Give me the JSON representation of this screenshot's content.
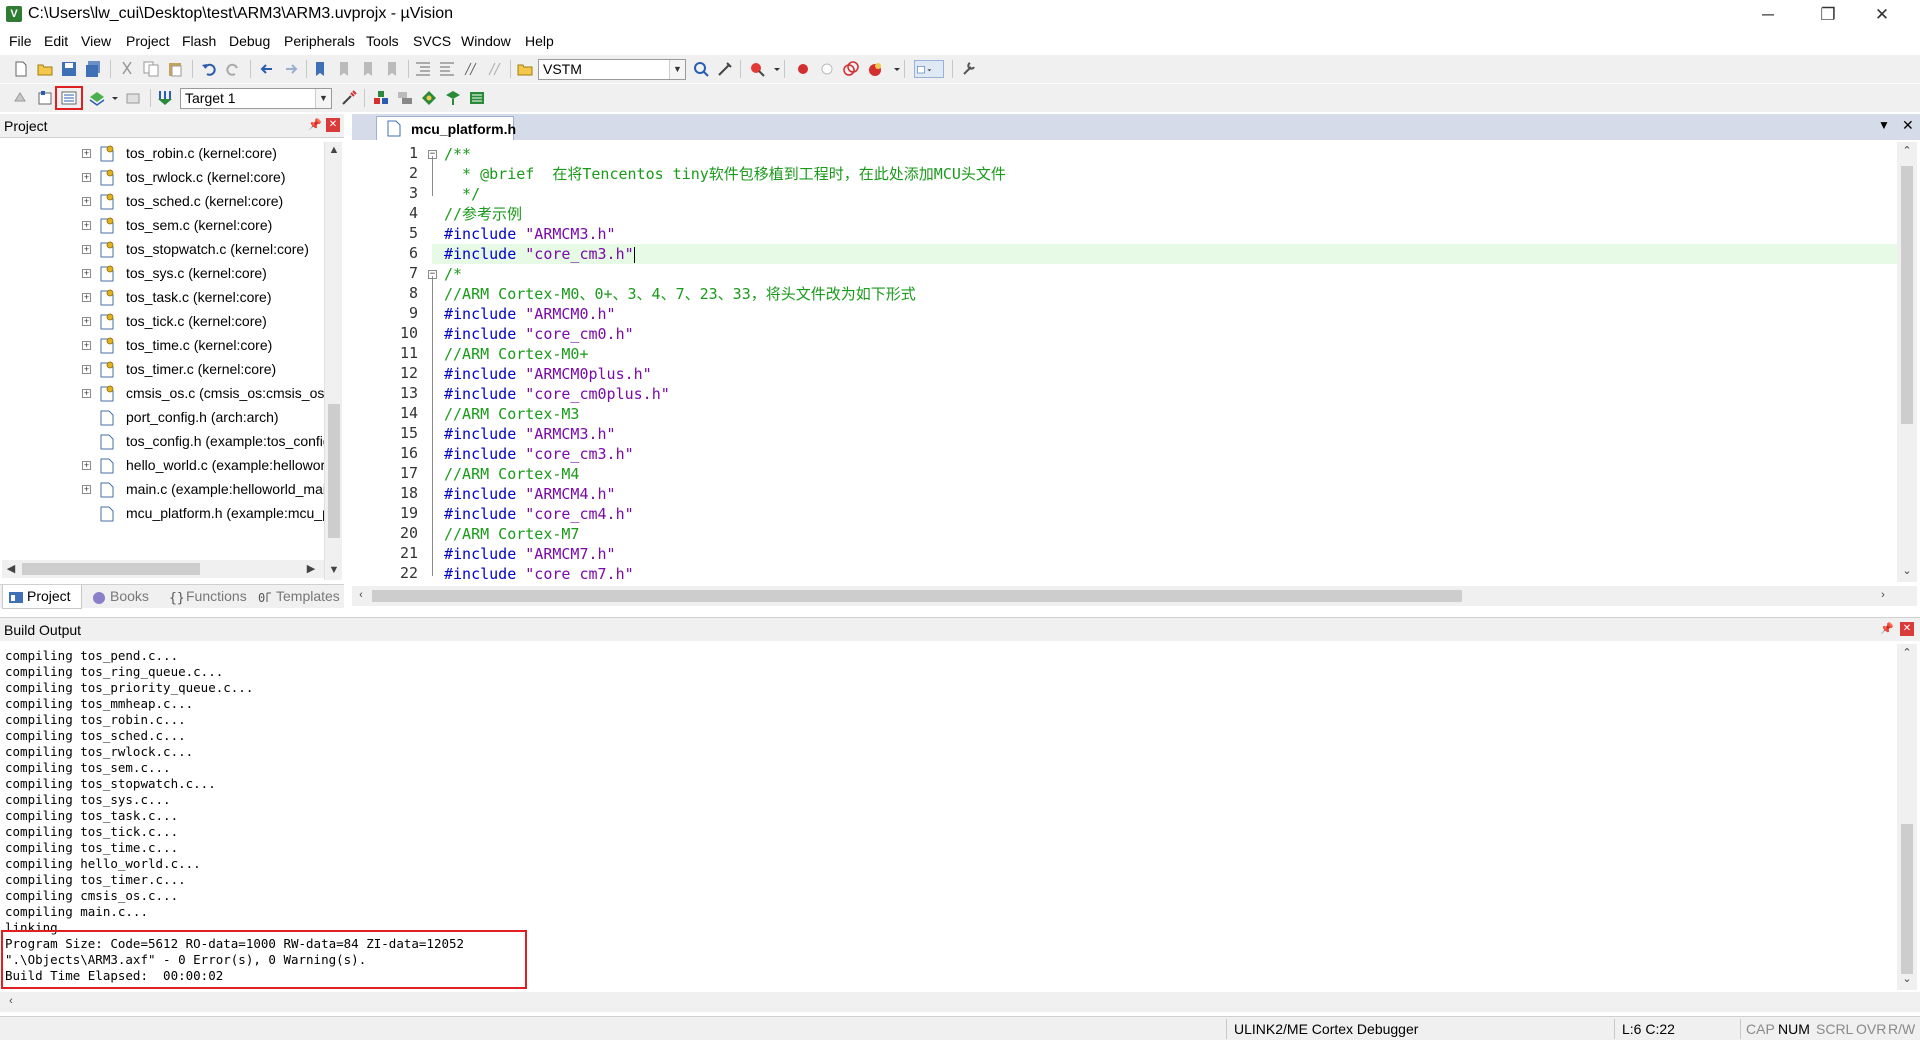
{
  "window": {
    "title": "C:\\Users\\lw_cui\\Desktop\\test\\ARM3\\ARM3.uvprojx - µVision",
    "minimize": "─",
    "restore": "❐",
    "close": "✕"
  },
  "menu": [
    "File",
    "Edit",
    "View",
    "Project",
    "Flash",
    "Debug",
    "Peripherals",
    "Tools",
    "SVCS",
    "Window",
    "Help"
  ],
  "toolbar": {
    "device_combo": "VSTM",
    "target_combo": "Target 1"
  },
  "project_pane": {
    "title": "Project",
    "files": [
      {
        "name": "tos_robin.c (kernel:core)",
        "expandable": true,
        "icon": "file-key-icon"
      },
      {
        "name": "tos_rwlock.c (kernel:core)",
        "expandable": true,
        "icon": "file-key-icon"
      },
      {
        "name": "tos_sched.c (kernel:core)",
        "expandable": true,
        "icon": "file-key-icon"
      },
      {
        "name": "tos_sem.c (kernel:core)",
        "expandable": true,
        "icon": "file-key-icon"
      },
      {
        "name": "tos_stopwatch.c (kernel:core)",
        "expandable": true,
        "icon": "file-key-icon"
      },
      {
        "name": "tos_sys.c (kernel:core)",
        "expandable": true,
        "icon": "file-key-icon"
      },
      {
        "name": "tos_task.c (kernel:core)",
        "expandable": true,
        "icon": "file-key-icon"
      },
      {
        "name": "tos_tick.c (kernel:core)",
        "expandable": true,
        "icon": "file-key-icon"
      },
      {
        "name": "tos_time.c (kernel:core)",
        "expandable": true,
        "icon": "file-key-icon"
      },
      {
        "name": "tos_timer.c (kernel:core)",
        "expandable": true,
        "icon": "file-key-icon"
      },
      {
        "name": "cmsis_os.c (cmsis_os:cmsis_os)",
        "expandable": true,
        "icon": "file-key-icon"
      },
      {
        "name": "port_config.h (arch:arch)",
        "expandable": false,
        "icon": "file-icon"
      },
      {
        "name": "tos_config.h (example:tos_config)",
        "expandable": false,
        "icon": "file-icon"
      },
      {
        "name": "hello_world.c (example:helloworld)",
        "expandable": true,
        "icon": "file-icon"
      },
      {
        "name": "main.c (example:helloworld_main)",
        "expandable": true,
        "icon": "file-icon"
      },
      {
        "name": "mcu_platform.h (example:mcu_platform)",
        "expandable": false,
        "icon": "file-icon"
      }
    ],
    "tabs": [
      "Project",
      "Books",
      "Functions",
      "Templates"
    ]
  },
  "editor": {
    "tab_label": "mcu_platform.h",
    "current_line": 6,
    "lines": [
      {
        "n": "1",
        "t": "/**",
        "cls": "c-com"
      },
      {
        "n": "2",
        "t": "  * @brief  在将Tencentos tiny软件包移植到工程时，在此处添加MCU头文件",
        "cls": "c-com"
      },
      {
        "n": "3",
        "t": "  */",
        "cls": "c-com"
      },
      {
        "n": "4",
        "t": "//参考示例",
        "cls": "c-com"
      },
      {
        "n": "5",
        "pp": "#include",
        "s": "\"ARMCM3.h\""
      },
      {
        "n": "6",
        "pp": "#include",
        "s": "\"core_cm3.h\""
      },
      {
        "n": "7",
        "t": "/*",
        "cls": "c-com"
      },
      {
        "n": "8",
        "t": "//ARM Cortex-M0、0+、3、4、7、23、33，将头文件改为如下形式",
        "cls": "c-com"
      },
      {
        "n": "9",
        "pp": "#include",
        "s": "\"ARMCM0.h\""
      },
      {
        "n": "10",
        "pp": "#include",
        "s": "\"core_cm0.h\""
      },
      {
        "n": "11",
        "t": "//ARM Cortex-M0+",
        "cls": "c-com"
      },
      {
        "n": "12",
        "pp": "#include",
        "s": "\"ARMCM0plus.h\""
      },
      {
        "n": "13",
        "pp": "#include",
        "s": "\"core_cm0plus.h\""
      },
      {
        "n": "14",
        "t": "//ARM Cortex-M3",
        "cls": "c-com"
      },
      {
        "n": "15",
        "pp": "#include",
        "s": "\"ARMCM3.h\""
      },
      {
        "n": "16",
        "pp": "#include",
        "s": "\"core_cm3.h\""
      },
      {
        "n": "17",
        "t": "//ARM Cortex-M4",
        "cls": "c-com"
      },
      {
        "n": "18",
        "pp": "#include",
        "s": "\"ARMCM4.h\""
      },
      {
        "n": "19",
        "pp": "#include",
        "s": "\"core_cm4.h\""
      },
      {
        "n": "20",
        "t": "//ARM Cortex-M7",
        "cls": "c-com"
      },
      {
        "n": "21",
        "pp": "#include",
        "s": "\"ARMCM7.h\""
      },
      {
        "n": "22",
        "pp": "#include",
        "s": "\"core_cm7.h\""
      }
    ]
  },
  "build_output": {
    "title": "Build Output",
    "lines": [
      "compiling tos_pend.c...",
      "compiling tos_ring_queue.c...",
      "compiling tos_priority_queue.c...",
      "compiling tos_mmheap.c...",
      "compiling tos_robin.c...",
      "compiling tos_sched.c...",
      "compiling tos_rwlock.c...",
      "compiling tos_sem.c...",
      "compiling tos_stopwatch.c...",
      "compiling tos_sys.c...",
      "compiling tos_task.c...",
      "compiling tos_tick.c...",
      "compiling tos_time.c...",
      "compiling hello_world.c...",
      "compiling tos_timer.c...",
      "compiling cmsis_os.c...",
      "compiling main.c...",
      "linking...",
      "Program Size: Code=5612 RO-data=1000 RW-data=84 ZI-data=12052",
      "\".\\Objects\\ARM3.axf\" - 0 Error(s), 0 Warning(s).",
      "Build Time Elapsed:  00:00:02"
    ]
  },
  "status": {
    "debugger": "ULINK2/ME Cortex Debugger",
    "position": "L:6 C:22",
    "cap": "CAP",
    "num": "NUM",
    "scrl": "SCRL",
    "ovr": "OVR",
    "rw": "R/W"
  }
}
